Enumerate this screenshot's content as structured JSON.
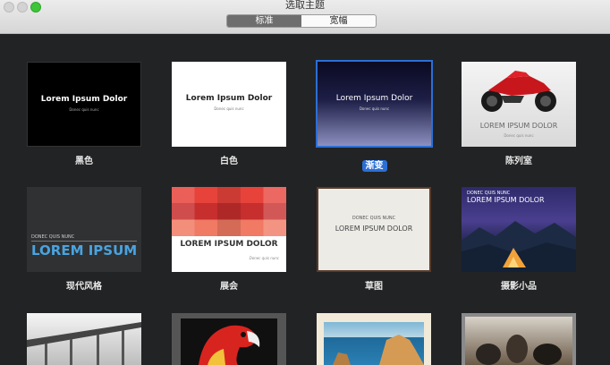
{
  "window": {
    "title": "选取主题"
  },
  "tabs": [
    {
      "label": "标准",
      "active": true
    },
    {
      "label": "宽幅",
      "active": false
    }
  ],
  "themes": [
    {
      "name": "黑色",
      "heading": "Lorem Ipsum Dolor",
      "sub": "Donec quis nunc"
    },
    {
      "name": "白色",
      "heading": "Lorem Ipsum Dolor",
      "sub": "Donec quis nunc"
    },
    {
      "name": "渐变",
      "heading": "Lorem Ipsum Dolor",
      "sub": "Donec quis nunc",
      "selected": true
    },
    {
      "name": "陈列室",
      "heading": "LOREM IPSUM DOLOR",
      "sub": "Donec quis nunc"
    },
    {
      "name": "现代风格",
      "kicker": "DONEC QUIS NUNC",
      "heading": "LOREM IPSUM"
    },
    {
      "name": "展会",
      "heading": "LOREM IPSUM DOLOR",
      "sub": "Donec quis nunc"
    },
    {
      "name": "草图",
      "kicker": "DONEC QUIS NUNC",
      "heading": "LOREM IPSUM DOLOR"
    },
    {
      "name": "摄影小品",
      "kicker": "DONEC QUIS NUNC",
      "heading": "LOREM IPSUM DOLOR"
    }
  ],
  "colors": {
    "selection": "#2b6fd6",
    "background": "#222324",
    "modern_accent": "#4aa3df"
  }
}
